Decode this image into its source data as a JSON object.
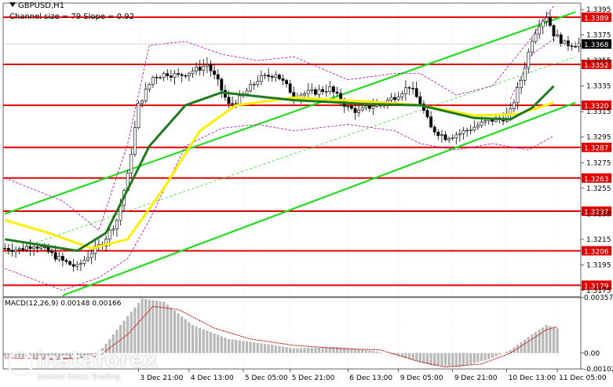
{
  "header": {
    "title": "GBPUSD,H1",
    "subtitle": "Channel size = 79 Slope = 0.92"
  },
  "macd": {
    "label": "MACD(12,26,9) 0.00148 0.00166",
    "ylim": [
      -0.00102,
      0.00357
    ],
    "axis_labels": [
      "0.00357",
      "0.00",
      "-0.00102"
    ]
  },
  "watermark": {
    "name": "instaforex",
    "tagline": "Instant Forex Trading"
  },
  "colors": {
    "candles": "#000000",
    "ma_slow": "#1e7a1e",
    "ma_fast": "#ffee00",
    "bands": "#b000b0",
    "channel": "#22dd22",
    "levels": "#e00000",
    "macd_hist": "#b8b8b8",
    "macd_signal": "#cc0000",
    "current_price_box": "#000000"
  },
  "chart_data": {
    "type": "candlestick",
    "title": "GBPUSD,H1",
    "ylim": [
      3170,
      3400
    ],
    "y_scale_note": "price values stored as pips above 1.0000 (e.g. 3389 = 1.3389)",
    "price_ticks": [
      "1.3395",
      "1.3375",
      "1.3355",
      "1.3335",
      "1.3315",
      "1.3295",
      "1.3275",
      "1.3255",
      "1.3235",
      "1.3215",
      "1.3195",
      "1.3175"
    ],
    "price_tick_values": [
      3395,
      3375,
      3355,
      3335,
      3315,
      3295,
      3275,
      3255,
      3235,
      3215,
      3195,
      3175
    ],
    "levels": [
      {
        "label": "1.3389",
        "value": 3389
      },
      {
        "label": "1.3352",
        "value": 3352
      },
      {
        "label": "1.3320",
        "value": 3320
      },
      {
        "label": "1.3287",
        "value": 3287
      },
      {
        "label": "1.3263",
        "value": 3263
      },
      {
        "label": "1.3237",
        "value": 3237
      },
      {
        "label": "1.3206",
        "value": 3206
      },
      {
        "label": "1.3179",
        "value": 3179
      }
    ],
    "current_price": {
      "label": "1.3368",
      "value": 3368
    },
    "x_tick_labels": [
      "3 Dec 21:00",
      "4 Dec 13:00",
      "5 Dec 05:00",
      "5 Dec 21:00",
      "6 Dec 13:00",
      "9 Dec 05:00",
      "9 Dec 21:00",
      "10 Dec 13:00",
      "11 Dec 05:00"
    ],
    "x_tick_bars": [
      37,
      51,
      66,
      79,
      95,
      109,
      124,
      139,
      153
    ],
    "n_bars": 160,
    "anchors": [
      [
        0,
        3208
      ],
      [
        4,
        3207
      ],
      [
        8,
        3211
      ],
      [
        12,
        3205
      ],
      [
        16,
        3198
      ],
      [
        20,
        3193
      ],
      [
        24,
        3205
      ],
      [
        27,
        3212
      ],
      [
        31,
        3230
      ],
      [
        34,
        3265
      ],
      [
        37,
        3320
      ],
      [
        41,
        3342
      ],
      [
        45,
        3345
      ],
      [
        48,
        3343
      ],
      [
        53,
        3348
      ],
      [
        56,
        3352
      ],
      [
        59,
        3338
      ],
      [
        62,
        3320
      ],
      [
        65,
        3325
      ],
      [
        70,
        3340
      ],
      [
        75,
        3345
      ],
      [
        80,
        3328
      ],
      [
        85,
        3330
      ],
      [
        90,
        3333
      ],
      [
        95,
        3318
      ],
      [
        98,
        3315
      ],
      [
        102,
        3320
      ],
      [
        105,
        3322
      ],
      [
        108,
        3327
      ],
      [
        112,
        3335
      ],
      [
        115,
        3322
      ],
      [
        118,
        3302
      ],
      [
        122,
        3295
      ],
      [
        126,
        3298
      ],
      [
        130,
        3303
      ],
      [
        134,
        3308
      ],
      [
        138,
        3310
      ],
      [
        140,
        3315
      ],
      [
        143,
        3340
      ],
      [
        146,
        3372
      ],
      [
        148,
        3384
      ],
      [
        150,
        3390
      ],
      [
        152,
        3376
      ],
      [
        155,
        3368
      ],
      [
        159,
        3368
      ]
    ],
    "ma_slow": [
      [
        0,
        3215
      ],
      [
        20,
        3206
      ],
      [
        28,
        3220
      ],
      [
        40,
        3288
      ],
      [
        50,
        3320
      ],
      [
        60,
        3330
      ],
      [
        80,
        3324
      ],
      [
        100,
        3321
      ],
      [
        115,
        3320
      ],
      [
        130,
        3310
      ],
      [
        140,
        3309
      ],
      [
        146,
        3318
      ],
      [
        152,
        3335
      ]
    ],
    "ma_fast": [
      [
        0,
        3230
      ],
      [
        12,
        3220
      ],
      [
        24,
        3208
      ],
      [
        34,
        3215
      ],
      [
        44,
        3255
      ],
      [
        54,
        3300
      ],
      [
        64,
        3320
      ],
      [
        80,
        3326
      ],
      [
        100,
        3323
      ],
      [
        115,
        3320
      ],
      [
        130,
        3312
      ],
      [
        142,
        3313
      ],
      [
        152,
        3322
      ]
    ],
    "band_upper": [
      [
        0,
        3263
      ],
      [
        16,
        3245
      ],
      [
        26,
        3222
      ],
      [
        34,
        3290
      ],
      [
        40,
        3367
      ],
      [
        50,
        3370
      ],
      [
        60,
        3360
      ],
      [
        70,
        3355
      ],
      [
        80,
        3358
      ],
      [
        95,
        3340
      ],
      [
        108,
        3345
      ],
      [
        115,
        3345
      ],
      [
        125,
        3328
      ],
      [
        135,
        3335
      ],
      [
        145,
        3370
      ],
      [
        152,
        3398
      ]
    ],
    "band_lower": [
      [
        0,
        3192
      ],
      [
        16,
        3175
      ],
      [
        26,
        3185
      ],
      [
        34,
        3200
      ],
      [
        40,
        3230
      ],
      [
        50,
        3288
      ],
      [
        60,
        3302
      ],
      [
        70,
        3305
      ],
      [
        80,
        3300
      ],
      [
        95,
        3305
      ],
      [
        108,
        3300
      ],
      [
        115,
        3290
      ],
      [
        125,
        3285
      ],
      [
        135,
        3290
      ],
      [
        145,
        3285
      ],
      [
        152,
        3296
      ]
    ],
    "band_upper_short": [
      [
        140,
        3325
      ],
      [
        146,
        3360
      ],
      [
        152,
        3372
      ]
    ],
    "channel_lines": [
      {
        "from": [
          0,
          3235
        ],
        "to": [
          158,
          3393
        ]
      },
      {
        "from": [
          16,
          3171
        ],
        "to": [
          158,
          3322
        ]
      }
    ],
    "channel_mid": {
      "from": [
        0,
        3204
      ],
      "to": [
        158,
        3358
      ]
    },
    "macd_hist": [
      [
        0,
        -0.0002
      ],
      [
        12,
        -0.0004
      ],
      [
        20,
        -0.0004
      ],
      [
        26,
        0.0
      ],
      [
        32,
        0.0018
      ],
      [
        38,
        0.0035
      ],
      [
        44,
        0.0033
      ],
      [
        52,
        0.0018
      ],
      [
        62,
        0.0009
      ],
      [
        72,
        0.0006
      ],
      [
        80,
        0.0003
      ],
      [
        92,
        0.0004
      ],
      [
        100,
        0.0002
      ],
      [
        108,
        -0.0001
      ],
      [
        118,
        -0.0008
      ],
      [
        126,
        -0.0009
      ],
      [
        134,
        -0.0004
      ],
      [
        140,
        0.0002
      ],
      [
        146,
        0.0012
      ],
      [
        150,
        0.0018
      ],
      [
        153,
        0.0016
      ]
    ],
    "macd_signal": [
      [
        0,
        -0.0003
      ],
      [
        14,
        -0.0004
      ],
      [
        26,
        -0.0002
      ],
      [
        34,
        0.0012
      ],
      [
        41,
        0.003
      ],
      [
        48,
        0.0028
      ],
      [
        58,
        0.0016
      ],
      [
        68,
        0.0009
      ],
      [
        80,
        0.0005
      ],
      [
        92,
        0.0003
      ],
      [
        104,
        0.0002
      ],
      [
        114,
        -0.0005
      ],
      [
        122,
        -0.0009
      ],
      [
        132,
        -0.0007
      ],
      [
        140,
        0.0
      ],
      [
        146,
        0.0009
      ],
      [
        150,
        0.0015
      ],
      [
        153,
        0.0017
      ]
    ]
  }
}
